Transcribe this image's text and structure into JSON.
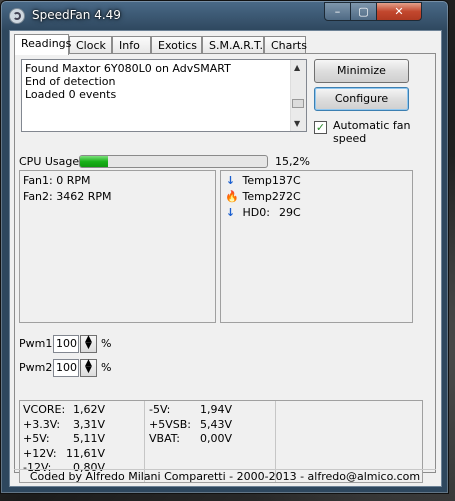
{
  "window": {
    "title": "SpeedFan 4.49"
  },
  "tabs": [
    {
      "label": "Readings"
    },
    {
      "label": "Clock"
    },
    {
      "label": "Info"
    },
    {
      "label": "Exotics"
    },
    {
      "label": "S.M.A.R.T."
    },
    {
      "label": "Charts"
    }
  ],
  "log": {
    "lines": [
      "Found Maxtor 6Y080L0 on AdvSMART",
      "End of detection",
      "Loaded 0 events"
    ]
  },
  "buttons": {
    "minimize": "Minimize",
    "configure": "Configure"
  },
  "auto_fan": {
    "label": "Automatic fan speed",
    "checked": true
  },
  "cpu": {
    "label": "CPU Usage",
    "value_text": "15,2%",
    "percent": 15.2
  },
  "fans": [
    {
      "text": "Fan1: 0 RPM"
    },
    {
      "text": "Fan2: 3462 RPM"
    }
  ],
  "temps": [
    {
      "name": "Temp1:",
      "value": "37C",
      "icon": "arrow-down-icon"
    },
    {
      "name": "Temp2:",
      "value": "72C",
      "icon": "flame-icon"
    },
    {
      "name": "HD0:",
      "value": "29C",
      "icon": "arrow-down-icon"
    }
  ],
  "pwm": [
    {
      "label": "Pwm1:",
      "value": "100",
      "unit": "%"
    },
    {
      "label": "Pwm2:",
      "value": "100",
      "unit": "%"
    }
  ],
  "voltages_left": [
    {
      "name": "VCORE:",
      "value": "1,62V"
    },
    {
      "name": "+3.3V:",
      "value": "3,31V"
    },
    {
      "name": "+5V:",
      "value": "5,11V"
    },
    {
      "name": "+12V:",
      "value": "11,61V"
    },
    {
      "name": "-12V:",
      "value": "0,80V"
    }
  ],
  "voltages_right": [
    {
      "name": "-5V:",
      "value": "1,94V"
    },
    {
      "name": "+5VSB:",
      "value": "5,43V"
    },
    {
      "name": "VBAT:",
      "value": "0,00V"
    }
  ],
  "footer": {
    "text": "Coded by Alfredo Milani Comparetti - 2000-2013 - alfredo@almico.com"
  },
  "colors": {
    "accent_title": "#2e475e",
    "cpu_bar": "#19b119",
    "close_button": "#c2472e"
  }
}
